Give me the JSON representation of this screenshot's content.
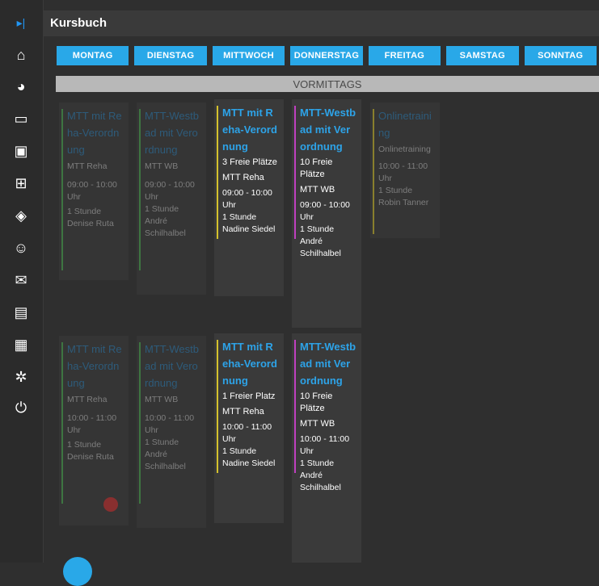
{
  "header": {
    "title": "Kursbuch"
  },
  "days": [
    "MONTAG",
    "DIENSTAG",
    "MITTWOCH",
    "DONNERSTAG",
    "FREITAG",
    "SAMSTAG",
    "SONNTAG"
  ],
  "section": "VORMITTAGS",
  "sidebar": {
    "items": [
      {
        "icon": "collapse-sidebar-icon",
        "glyph": "▸|"
      },
      {
        "icon": "home-icon",
        "glyph": "⌂"
      },
      {
        "icon": "pie-chart-icon",
        "glyph": "◕"
      },
      {
        "icon": "card-icon",
        "glyph": "▭"
      },
      {
        "icon": "calendar-icon",
        "glyph": "▣"
      },
      {
        "icon": "book-icon",
        "glyph": "⊞"
      },
      {
        "icon": "cube-icon",
        "glyph": "◈"
      },
      {
        "icon": "smiley-icon",
        "glyph": "☺"
      },
      {
        "icon": "mail-icon",
        "glyph": "✉"
      },
      {
        "icon": "newspaper-icon",
        "glyph": "▤"
      },
      {
        "icon": "film-icon",
        "glyph": "▦"
      },
      {
        "icon": "settings-icon",
        "glyph": "✲"
      },
      {
        "icon": "logout-icon",
        "glyph": "⏻"
      }
    ]
  },
  "cards": [
    {
      "title": "MTT mit Reha-Verordnung",
      "free": "",
      "course": "MTT Reha",
      "time": "09:00 - 10:00 Uhr",
      "duration": "1 Stunde",
      "trainer": "Denise Ruta",
      "color": "#4caf50"
    },
    {
      "title": "MTT-Westbad mit Verordnung",
      "free": "",
      "course": "MTT WB",
      "time": "09:00 - 10:00 Uhr",
      "duration": "1 Stunde",
      "trainer": "André Schilhalbel",
      "color": "#4caf50"
    },
    {
      "title": "MTT mit Reha-Verordnung",
      "free": "3 Freie Plätze",
      "course": "MTT Reha",
      "time": "09:00 - 10:00 Uhr",
      "duration": "1 Stunde",
      "trainer": "Nadine Siedel",
      "color": "#d4c12c"
    },
    {
      "title": "MTT-Westbad mit Verordnung",
      "free": "10 Freie Plätze",
      "course": "MTT WB",
      "time": "09:00 - 10:00 Uhr",
      "duration": "1 Stunde",
      "trainer": "André Schilhalbel",
      "color": "#c040c0"
    },
    {
      "title": "Onlinetraining",
      "free": "",
      "course": "Onlinetraining",
      "time": "10:00 - 11:00 Uhr",
      "duration": "1 Stunde",
      "trainer": "Robin Tanner",
      "color": "#d4c12c"
    },
    {
      "title": "MTT mit Reha-Verordnung",
      "free": "",
      "course": "MTT Reha",
      "time": "10:00 - 11:00 Uhr",
      "duration": "1 Stunde",
      "trainer": "Denise Ruta",
      "color": "#4caf50"
    },
    {
      "title": "MTT-Westbad mit Verordnung",
      "free": "",
      "course": "MTT WB",
      "time": "10:00 - 11:00 Uhr",
      "duration": "1 Stunde",
      "trainer": "André Schilhalbel",
      "color": "#4caf50"
    },
    {
      "title": "MTT mit Reha-Verordnung",
      "free": "1 Freier Platz",
      "course": "MTT Reha",
      "time": "10:00 - 11:00 Uhr",
      "duration": "1 Stunde",
      "trainer": "Nadine Siedel",
      "color": "#d4c12c"
    },
    {
      "title": "MTT-Westbad mit Verordnung",
      "free": "10 Freie Plätze",
      "course": "MTT WB",
      "time": "10:00 - 11:00 Uhr",
      "duration": "1 Stunde",
      "trainer": "André Schilhalbel",
      "color": "#c040c0"
    }
  ]
}
